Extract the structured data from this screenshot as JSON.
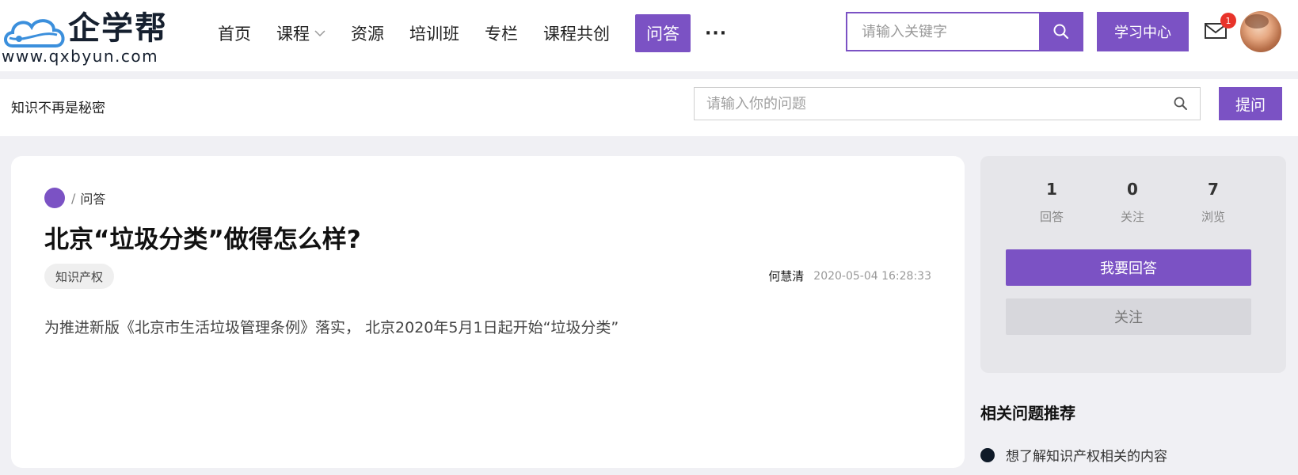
{
  "logo": {
    "title": "企学帮",
    "url": "www.qxbyun.com"
  },
  "nav": {
    "items": [
      {
        "label": "首页",
        "has_dropdown": false,
        "active": false
      },
      {
        "label": "课程",
        "has_dropdown": true,
        "active": false
      },
      {
        "label": "资源",
        "has_dropdown": false,
        "active": false
      },
      {
        "label": "培训班",
        "has_dropdown": false,
        "active": false
      },
      {
        "label": "专栏",
        "has_dropdown": false,
        "active": false
      },
      {
        "label": "课程共创",
        "has_dropdown": false,
        "active": false
      },
      {
        "label": "问答",
        "has_dropdown": false,
        "active": true
      }
    ],
    "more_label": "···"
  },
  "top_search": {
    "placeholder": "请输入关键字",
    "value": ""
  },
  "study_center_label": "学习中心",
  "mail": {
    "badge_count": "1",
    "icon": "mail-icon"
  },
  "subbar": {
    "slogan": "知识不再是秘密",
    "question_search_placeholder": "请输入你的问题",
    "ask_label": "提问"
  },
  "question": {
    "breadcrumb_current": "问答",
    "title": "北京“垃圾分类”做得怎么样?",
    "tag": "知识产权",
    "author": "何慧清",
    "time": "2020-05-04 16:28:33",
    "body": "为推进新版《北京市生活垃圾管理条例》落实， 北京2020年5月1日起开始“垃圾分类”"
  },
  "stats": [
    {
      "value": "1",
      "label": "回答"
    },
    {
      "value": "0",
      "label": "关注"
    },
    {
      "value": "7",
      "label": "浏览"
    }
  ],
  "actions": {
    "answer_label": "我要回答",
    "follow_label": "关注"
  },
  "related": {
    "title": "相关问题推荐",
    "items": [
      {
        "text": "想了解知识产权相关的内容"
      }
    ]
  },
  "colors": {
    "accent": "#7b52c4",
    "badge": "#e8332a",
    "page_bg": "#f0f0f4"
  }
}
